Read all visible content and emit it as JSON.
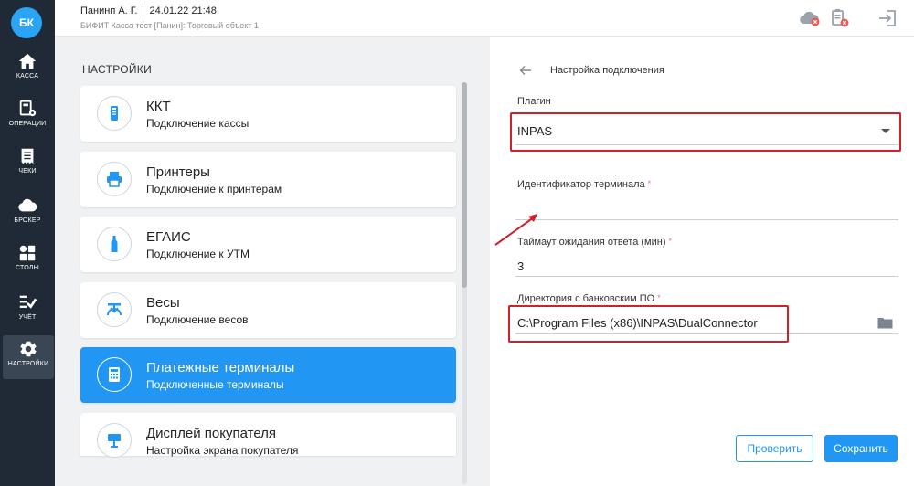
{
  "sidebar": {
    "logo": "БК",
    "items": [
      {
        "label": "КАССА",
        "icon": "home-icon"
      },
      {
        "label": "ОПЕРАЦИИ",
        "icon": "operations-icon"
      },
      {
        "label": "ЧЕКИ",
        "icon": "receipt-icon"
      },
      {
        "label": "БРОКЕР",
        "icon": "cloud-icon"
      },
      {
        "label": "СТОЛЫ",
        "icon": "tables-icon"
      },
      {
        "label": "УЧЁТ",
        "icon": "accounting-icon"
      },
      {
        "label": "НАСТРОЙКИ",
        "icon": "gear-icon",
        "active": true
      }
    ]
  },
  "header": {
    "user": "Панинп А. Г.",
    "datetime": "24.01.22 21:48",
    "subtitle": "БИФИТ Касса тест [Панин]: Торговый объект 1",
    "icons": [
      "cloud-status-icon",
      "clipboard-status-icon",
      "logout-icon"
    ]
  },
  "settings": {
    "title": "НАСТРОЙКИ",
    "cards": [
      {
        "title": "ККТ",
        "subtitle": "Подключение кассы",
        "icon": "kkt-icon"
      },
      {
        "title": "Принтеры",
        "subtitle": "Подключение к принтерам",
        "icon": "printer-icon"
      },
      {
        "title": "ЕГАИС",
        "subtitle": "Подключение к УТМ",
        "icon": "bottle-icon"
      },
      {
        "title": "Весы",
        "subtitle": "Подключение весов",
        "icon": "scales-icon"
      },
      {
        "title": "Платежные терминалы",
        "subtitle": "Подключенные терминалы",
        "icon": "calculator-icon",
        "active": true
      },
      {
        "title": "Дисплей покупателя",
        "subtitle": "Настройка экрана покупателя",
        "icon": "display-icon"
      }
    ]
  },
  "connection": {
    "title": "Настройка подключения",
    "plugin_label": "Плагин",
    "plugin_value": "INPAS",
    "terminal_id_label": "Идентификатор терминала",
    "terminal_id_value": "",
    "timeout_label": "Таймаут ожидания ответа (мин)",
    "timeout_value": "3",
    "directory_label": "Директория с банковским ПО",
    "directory_value": "C:\\Program Files (x86)\\INPAS\\DualConnector",
    "required_mark": "*"
  },
  "actions": {
    "check_label": "Проверить",
    "save_label": "Сохранить"
  },
  "colors": {
    "accent": "#2196f3",
    "sidebar": "#1f2a36",
    "highlight": "#d0202a"
  }
}
